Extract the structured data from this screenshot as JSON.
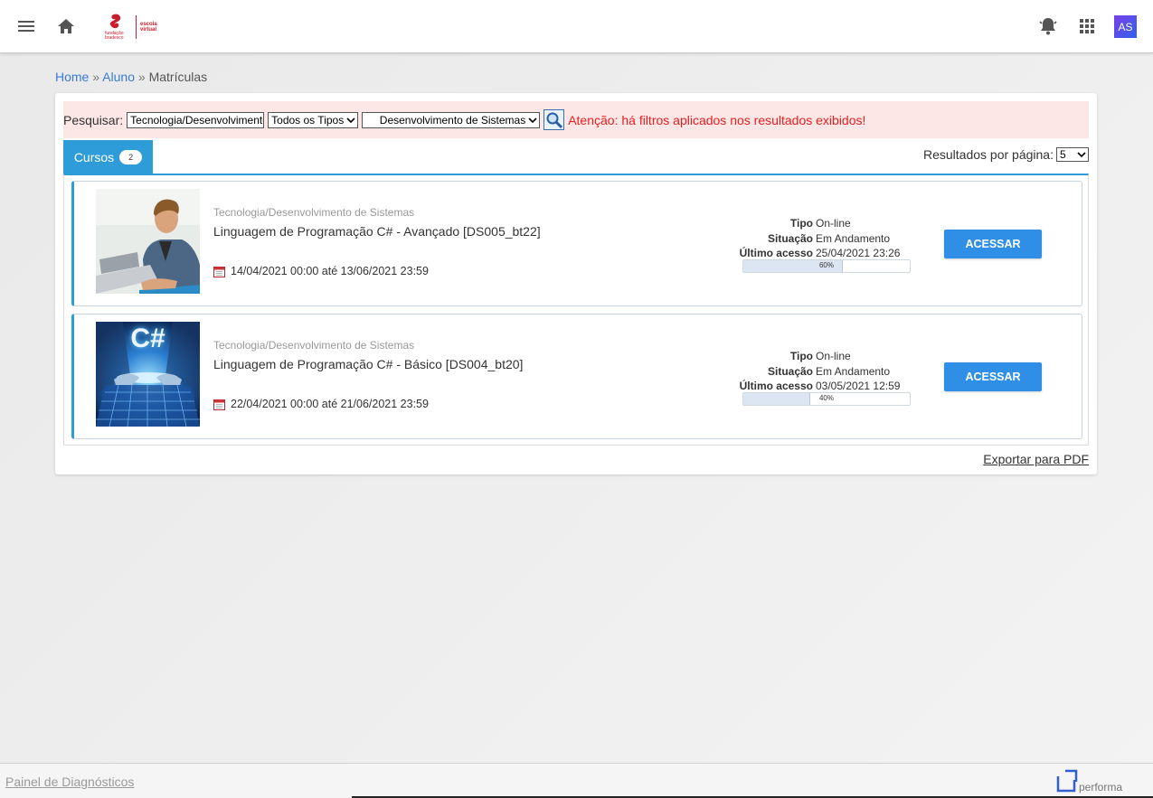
{
  "topbar": {
    "menu_icon": "hamburger-menu-icon",
    "home_icon": "home-icon",
    "logo": {
      "left_text": "fundação bradesco",
      "right_text": "escola virtual"
    },
    "bell_icon": "bell-alert-icon",
    "apps_icon": "apps-grid-icon",
    "avatar_initials": "AS"
  },
  "breadcrumb": {
    "home": "Home",
    "sep1": "»",
    "aluno": "Aluno",
    "sep2": "»",
    "current": "Matrículas"
  },
  "search": {
    "label": "Pesquisar:",
    "query_value": "Tecnologia/Desenvolvimento de Sistemas",
    "type_select": "Todos os Tipos",
    "area_select": "Desenvolvimento de Sistemas",
    "warning": "Atenção: há filtros aplicados nos resultados exibidos!"
  },
  "tabs": {
    "cursos_label": "Cursos",
    "cursos_count": "2"
  },
  "pagination": {
    "label": "Resultados por página:",
    "value": "5"
  },
  "courses": [
    {
      "category": "Tecnologia/Desenvolvimento de Sistemas",
      "title": "Linguagem de Programação C# - Avançado [DS005_bt22]",
      "period": "14/04/2021 00:00 até 13/06/2021 23:59",
      "tipo_label": "Tipo",
      "tipo": "On-line",
      "situacao_label": "Situação",
      "situacao": "Em Andamento",
      "acesso_label": "Último acesso",
      "acesso": "25/04/2021 23:26",
      "progress": 0.6,
      "progress_label": "60%",
      "button": "ACESSAR",
      "thumb_text": ""
    },
    {
      "category": "Tecnologia/Desenvolvimento de Sistemas",
      "title": "Linguagem de Programação C# - Básico [DS004_bt20]",
      "period": "22/04/2021 00:00 até 21/06/2021 23:59",
      "tipo_label": "Tipo",
      "tipo": "On-line",
      "situacao_label": "Situação",
      "situacao": "Em Andamento",
      "acesso_label": "Último acesso",
      "acesso": "03/05/2021 12:59",
      "progress": 0.4,
      "progress_label": "40%",
      "button": "ACESSAR",
      "thumb_text": "C#"
    }
  ],
  "export_label": "Exportar para PDF",
  "footer": {
    "diagnostics": "Painel de Diagnósticos",
    "brand": "performa"
  },
  "colors": {
    "accent": "#2e9cd8",
    "button": "#2f8fe6",
    "warning": "#e52020",
    "brand": "#cc1b2c"
  }
}
